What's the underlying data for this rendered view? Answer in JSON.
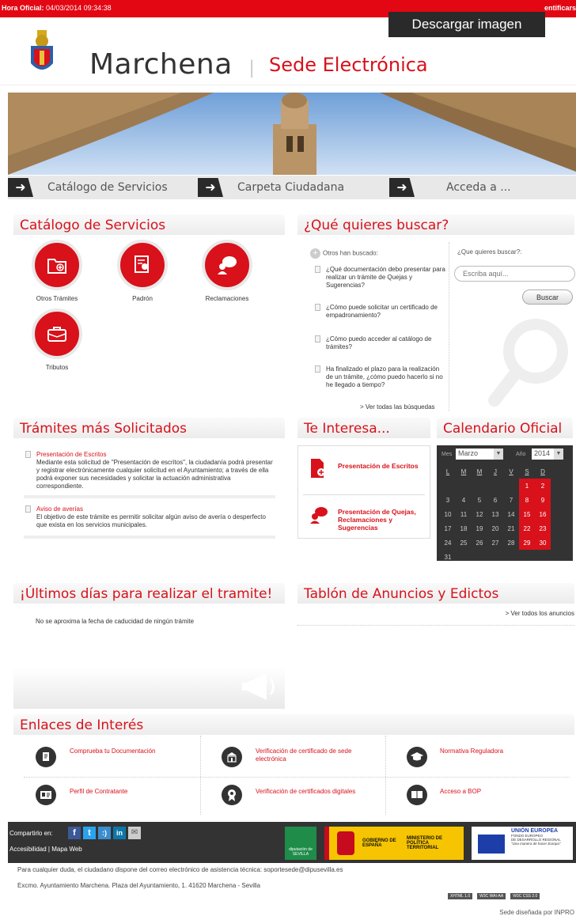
{
  "topbar": {
    "time_label": "Hora Oficial:",
    "time_value": "04/03/2014 09:34:38",
    "right_text": "entificars"
  },
  "download_button": "Descargar imagen",
  "header": {
    "title": "Marchena",
    "separator": "|",
    "subtitle": "Sede Electrónica"
  },
  "nav": [
    {
      "label": "Catálogo de Servicios"
    },
    {
      "label": "Carpeta Ciudadana"
    },
    {
      "label": "Acceda a ..."
    }
  ],
  "catalog": {
    "title": "Catálogo de Servicios",
    "items": [
      {
        "label": "Otros Trámites",
        "icon": "folder-plus-icon"
      },
      {
        "label": "Padrón",
        "icon": "certificate-icon"
      },
      {
        "label": "Reclamaciones",
        "icon": "speech-user-icon"
      },
      {
        "label": "Tributos",
        "icon": "briefcase-icon"
      }
    ]
  },
  "search": {
    "title": "¿Qué quieres buscar?",
    "others_label": "Otros han buscado:",
    "queries": [
      "¿Qué documentación debo presentar para realizar un trámite de Quejas y Sugerencias?",
      "¿Cómo puede solicitar un certificado de empadronamiento?",
      "¿Cómo puedo acceder al catálogo de trámites?",
      "Ha finalizado el plazo para la realización de un trámite, ¿cómo puedo hacerlo si no he llegado a tiempo?"
    ],
    "see_all": "> Ver todas las búsquedas",
    "field_label": "¿Que quieres buscar?:",
    "placeholder": "Escriba aquí...",
    "button": "Buscar"
  },
  "tramites": {
    "title": "Trámites más Solicitados",
    "items": [
      {
        "title": "Presentación de Escritos",
        "desc": "Mediante esta solicitud de \"Presentación de escritos\", la ciudadanía podrá presentar y registrar electrónicamente cualquier solicitud en el Ayuntamiento; a través de ella podrá exponer sus necesidades y solicitar la actuación administrativa correspondiente."
      },
      {
        "title": "Aviso de averías",
        "desc": "El objetivo de este trámite es permitir solicitar algún aviso de avería o desperfecto que exista en los servicios municipales."
      }
    ]
  },
  "interesa": {
    "title": "Te Interesa...",
    "items": [
      {
        "label": "Presentación de Escritos"
      },
      {
        "label": "Presentación de Quejas, Reclamaciones y Sugerencias"
      }
    ]
  },
  "calendar": {
    "title": "Calendario Oficial",
    "mes_label": "Mes",
    "mes_value": "Marzo",
    "anio_label": "Año",
    "anio_value": "2014",
    "weekdays": [
      "L",
      "M",
      "M",
      "J",
      "V",
      "S",
      "D"
    ],
    "weeks": [
      [
        "",
        "",
        "",
        "",
        "",
        "1",
        "2"
      ],
      [
        "3",
        "4",
        "5",
        "6",
        "7",
        "8",
        "9"
      ],
      [
        "10",
        "11",
        "12",
        "13",
        "14",
        "15",
        "16"
      ],
      [
        "17",
        "18",
        "19",
        "20",
        "21",
        "22",
        "23"
      ],
      [
        "24",
        "25",
        "26",
        "27",
        "28",
        "29",
        "30"
      ],
      [
        "31",
        "",
        "",
        "",
        "",
        "",
        ""
      ]
    ]
  },
  "ultimos": {
    "title": "¡Últimos días para realizar el tramite!",
    "text": "No se aproxima la fecha de caducidad de ningún trámite"
  },
  "tablon": {
    "title": "Tablón de Anuncios y Edictos",
    "link": "> Ver todos los anuncios"
  },
  "enlaces": {
    "title": "Enlaces de Interés",
    "items": [
      {
        "label": "Comprueba tu Documentación",
        "icon": "document-hand-icon"
      },
      {
        "label": "Verificación de certificado de sede electrónica",
        "icon": "building-icon"
      },
      {
        "label": "Normativa Reguladora",
        "icon": "graduation-cap-icon"
      },
      {
        "label": "Perfil de Contratante",
        "icon": "id-card-icon"
      },
      {
        "label": "Verificación de certificados digitales",
        "icon": "medal-icon"
      },
      {
        "label": "Acceso a BOP",
        "icon": "book-icon"
      }
    ]
  },
  "footer": {
    "share_label": "Compartirlo en:",
    "links": "Accesibilidad | Mapa Web",
    "logo_diputacion": "diputación de SEVILLA",
    "logo_gobierno": "GOBIERNO DE ESPAÑA",
    "logo_ministerio": "MINISTERIO DE POLÍTICA TERRITORIAL",
    "eu_title": "UNIÓN EUROPEA",
    "eu_sub1": "FONDO EUROPEO",
    "eu_sub2": "DE DESARROLLO REGIONAL",
    "eu_sub3": "\"Una manera de hacer Europa\"",
    "contact": "Para cualquier duda, el ciudadano dispone del correo electrónico de asistencia técnica: soportesede@dipusevilla.es",
    "address": "Excmo. Ayuntamiento Marchena. Plaza del Ayuntamiento, 1. 41620 Marchena - Sevilla",
    "badges": [
      "XHTML 1.0",
      "W3C WAI-AA",
      "W3C CSS 2.0"
    ],
    "credit": "Sede diseñada por INPRO"
  },
  "colors": {
    "accent": "#d8111b",
    "dark": "#333333"
  }
}
